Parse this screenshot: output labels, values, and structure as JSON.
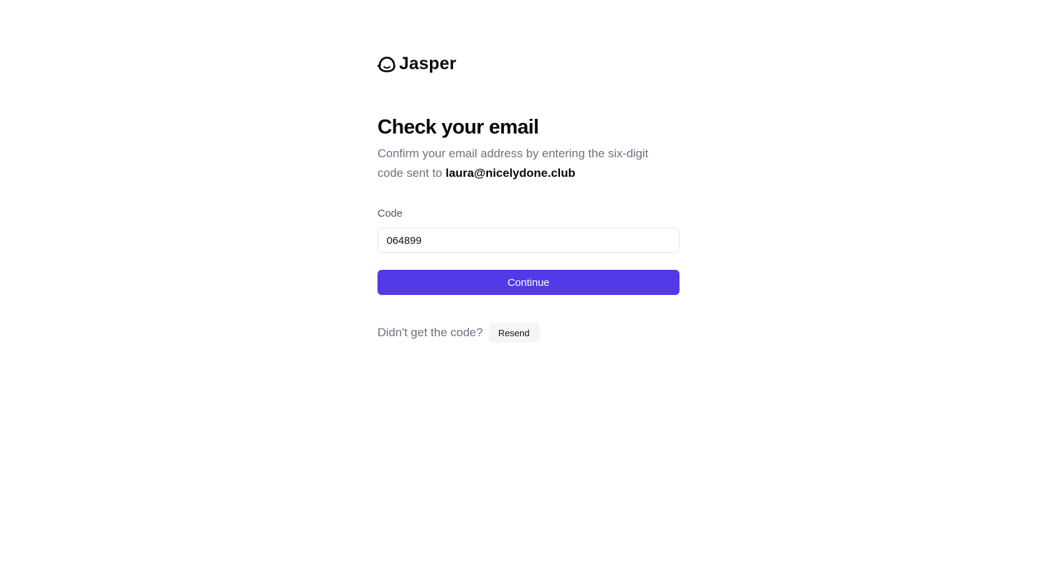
{
  "brand": {
    "name": "Jasper",
    "logo_icon": "jasper-logo-icon"
  },
  "page": {
    "title": "Check your email",
    "subtitle_prefix": "Confirm your email address by entering the six-digit code sent to ",
    "email": "laura@nicelydone.club"
  },
  "form": {
    "code_label": "Code",
    "code_value": "064899",
    "continue_label": "Continue"
  },
  "resend": {
    "prompt": "Didn't get the code?",
    "button_label": "Resend"
  },
  "colors": {
    "primary": "#523be6",
    "muted_text": "#6b7280",
    "input_border": "#e5e7eb",
    "secondary_button_bg": "#f5f5f5"
  }
}
